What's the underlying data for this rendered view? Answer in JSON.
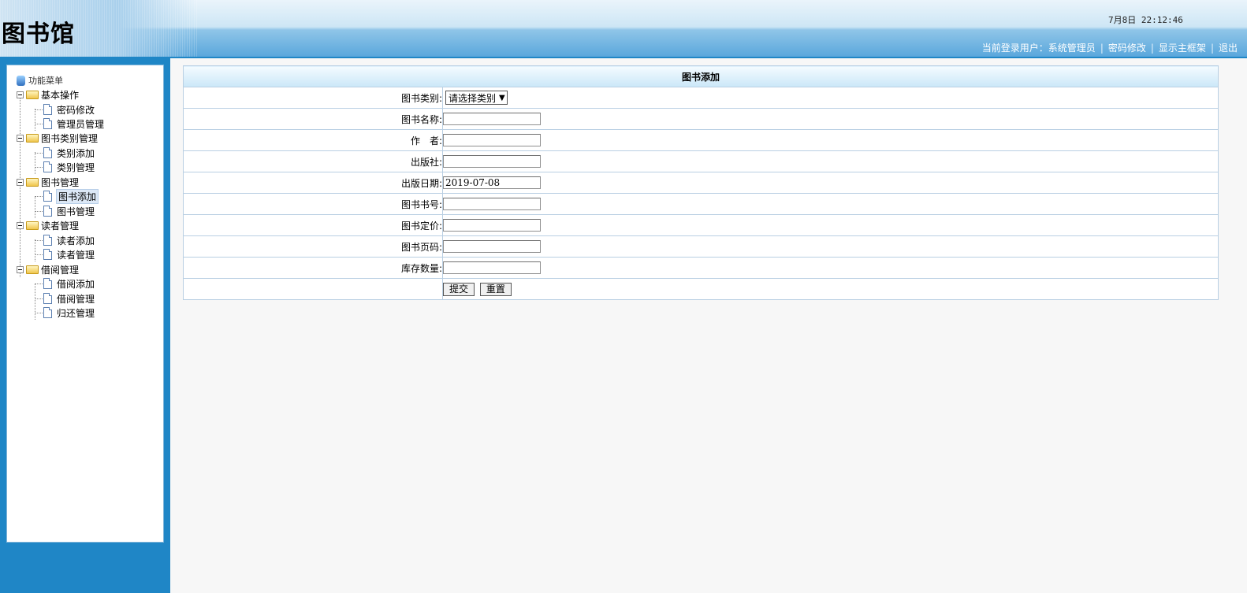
{
  "header": {
    "logo_text": "图书馆",
    "clock": "7月8日 22:12:46",
    "user_label": "当前登录用户：",
    "user_name": "系统管理员",
    "links": [
      "密码修改",
      "显示主框架",
      "退出"
    ]
  },
  "sidebar": {
    "root": "功能菜单",
    "groups": [
      {
        "label": "基本操作",
        "items": [
          "密码修改",
          "管理员管理"
        ]
      },
      {
        "label": "图书类别管理",
        "items": [
          "类别添加",
          "类别管理"
        ]
      },
      {
        "label": "图书管理",
        "items": [
          "图书添加",
          "图书管理"
        ]
      },
      {
        "label": "读者管理",
        "items": [
          "读者添加",
          "读者管理"
        ]
      },
      {
        "label": "借阅管理",
        "items": [
          "借阅添加",
          "借阅管理",
          "归还管理"
        ]
      }
    ],
    "selected": "图书添加"
  },
  "form": {
    "title": "图书添加",
    "category_label": "图书类别:",
    "category_selected": "请选择类别",
    "fields": [
      {
        "label": "图书名称:",
        "value": ""
      },
      {
        "label": "作　者:",
        "value": ""
      },
      {
        "label": "出版社:",
        "value": ""
      },
      {
        "label": "出版日期:",
        "value": "2019-07-08"
      },
      {
        "label": "图书书号:",
        "value": ""
      },
      {
        "label": "图书定价:",
        "value": ""
      },
      {
        "label": "图书页码:",
        "value": ""
      },
      {
        "label": "库存数量:",
        "value": ""
      }
    ],
    "submit_label": "提交",
    "reset_label": "重置"
  },
  "colors": {
    "sidebar_bg": "#1f86c6",
    "page_bg": "#f7f7f7",
    "header_blue": "#5aa7dc"
  }
}
